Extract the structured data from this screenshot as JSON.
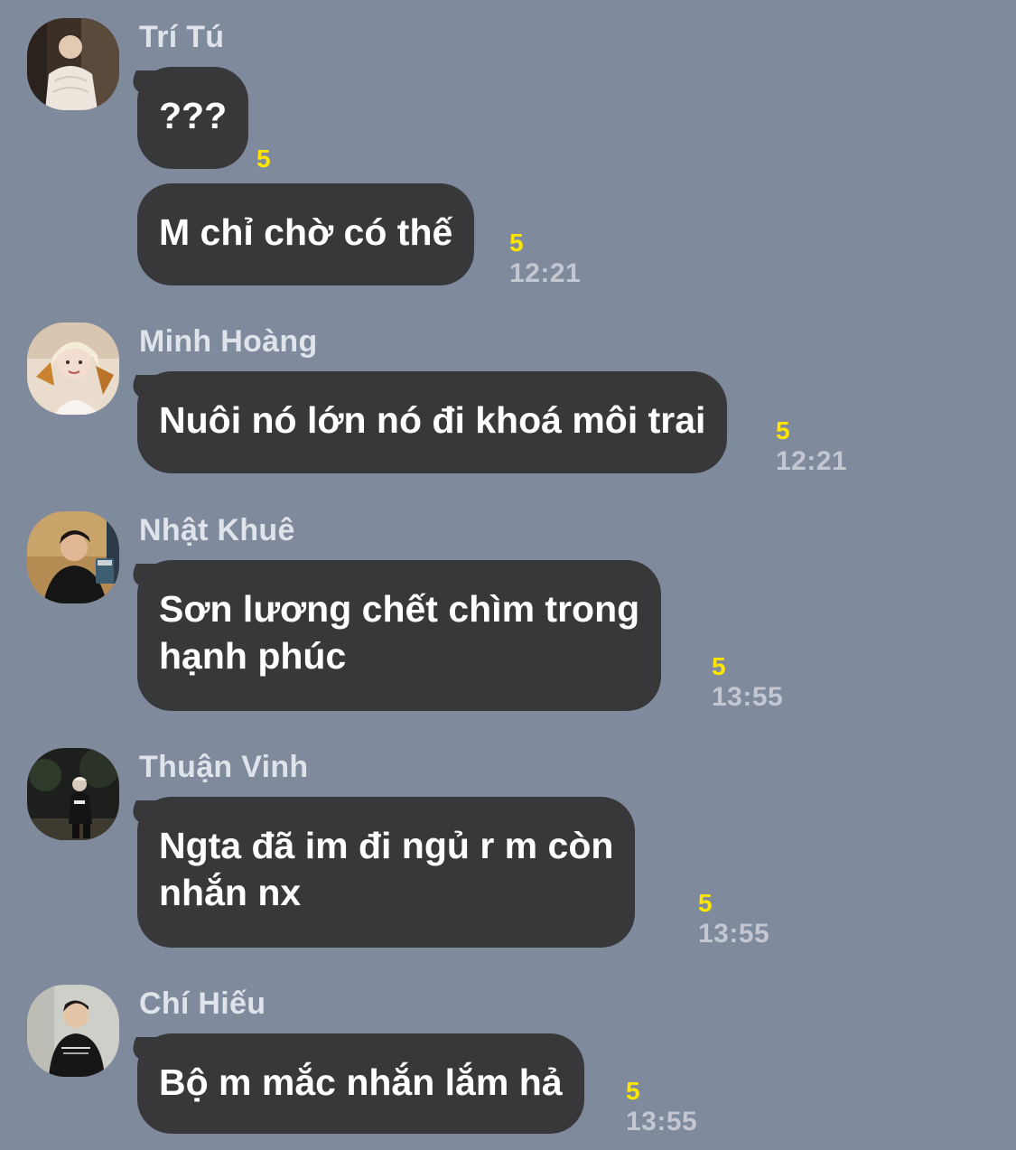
{
  "colors": {
    "background": "#7f8a9d",
    "bubble": "#38383b",
    "read_count": "#ffe500",
    "timestamp": "#c2c7d1",
    "sender_name": "#dfe3ea"
  },
  "messages": [
    {
      "sender": "Trí Tú",
      "avatar_icon": "person-photo-avatar",
      "bubbles": [
        {
          "text": "???",
          "read": "5",
          "time": ""
        },
        {
          "text": "M chỉ chờ có thế",
          "read": "5",
          "time": "12:21"
        }
      ]
    },
    {
      "sender": "Minh Hoàng",
      "avatar_icon": "person-photo-avatar",
      "bubbles": [
        {
          "text": "Nuôi nó lớn nó đi khoá môi trai",
          "read": "5",
          "time": "12:21"
        }
      ]
    },
    {
      "sender": "Nhật Khuê",
      "avatar_icon": "person-photo-avatar",
      "bubbles": [
        {
          "line1": "Sơn lương chết chìm trong",
          "line2": "hạnh phúc",
          "read": "5",
          "time": "13:55"
        }
      ]
    },
    {
      "sender": "Thuận Vinh",
      "avatar_icon": "person-photo-avatar",
      "bubbles": [
        {
          "line1": "Ngta đã im đi ngủ r m còn",
          "line2": "nhắn nx",
          "read": "5",
          "time": "13:55"
        }
      ]
    },
    {
      "sender": "Chí Hiếu",
      "avatar_icon": "person-photo-avatar",
      "bubbles": [
        {
          "text": "Bộ m mắc nhắn lắm hả",
          "read": "5",
          "time": "13:55"
        }
      ]
    }
  ]
}
